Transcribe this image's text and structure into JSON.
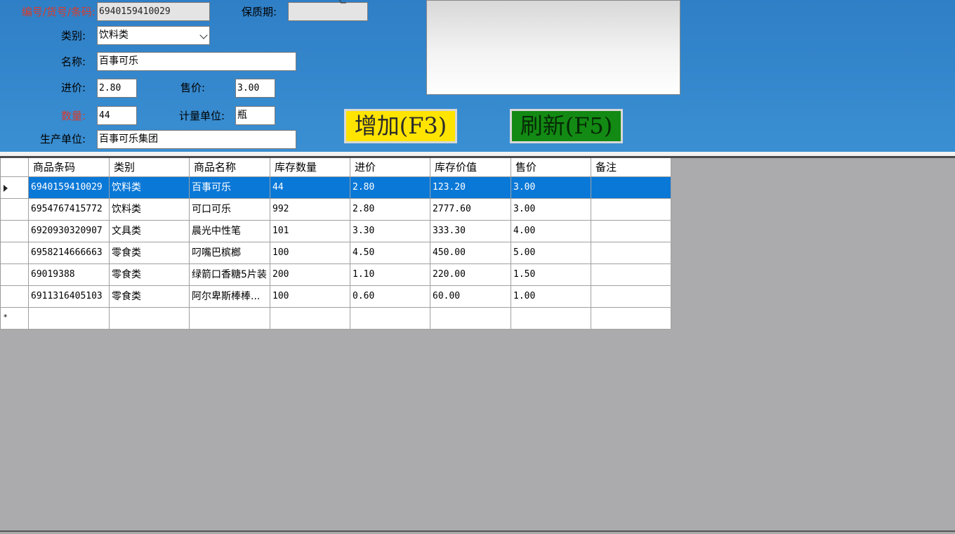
{
  "form": {
    "barcode_label": "编号/货号/条码:",
    "barcode_value": "6940159410029",
    "shelf_life_label": "保质期:",
    "shelf_life_value": "",
    "category_label": "类别:",
    "category_value": "饮料类",
    "name_label": "名称:",
    "name_value": "百事可乐",
    "cost_label": "进价:",
    "cost_value": "2.80",
    "price_label": "售价:",
    "price_value": "3.00",
    "qty_label": "数量:",
    "qty_value": "44",
    "unit_label": "计量单位:",
    "unit_value": "瓶",
    "maker_label": "生产单位:",
    "maker_value": "百事可乐集团"
  },
  "buttons": {
    "add_label": "增加(F3)",
    "refresh_label": "刷新(F5)"
  },
  "grid": {
    "columns": [
      "商品条码",
      "类别",
      "商品名称",
      "库存数量",
      "进价",
      "库存价值",
      "售价",
      "备注"
    ],
    "rows": [
      [
        "6940159410029",
        "饮料类",
        "百事可乐",
        "44",
        "2.80",
        "123.20",
        "3.00",
        ""
      ],
      [
        "6954767415772",
        "饮料类",
        "可口可乐",
        "992",
        "2.80",
        "2777.60",
        "3.00",
        ""
      ],
      [
        "6920930320907",
        "文具类",
        "晨光中性笔",
        "101",
        "3.30",
        "333.30",
        "4.00",
        ""
      ],
      [
        "6958214666663",
        "零食类",
        "叼嘴巴槟榔",
        "100",
        "4.50",
        "450.00",
        "5.00",
        ""
      ],
      [
        "69019388",
        "零食类",
        "绿箭口香糖5片装",
        "200",
        "1.10",
        "220.00",
        "1.50",
        ""
      ],
      [
        "6911316405103",
        "零食类",
        "阿尔卑斯棒棒...",
        "100",
        "0.60",
        "60.00",
        "1.00",
        ""
      ]
    ],
    "selected_row": 0,
    "new_row_marker": "*"
  },
  "colors": {
    "panel": "#3a8fd2",
    "required_label": "#d83a2a",
    "add_button": "#ffe400",
    "refresh_button": "#138a13",
    "selection": "#0a78d7"
  }
}
